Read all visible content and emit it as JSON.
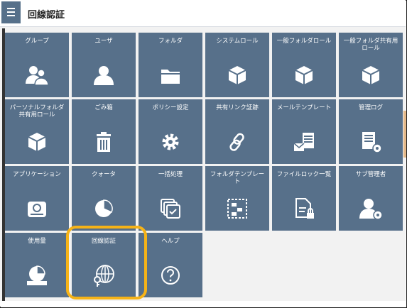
{
  "header": {
    "title": "回線認証"
  },
  "tiles": [
    {
      "label": "グループ",
      "icon": "group-icon"
    },
    {
      "label": "ユーザ",
      "icon": "user-icon"
    },
    {
      "label": "フォルダ",
      "icon": "folder-icon"
    },
    {
      "label": "システムロール",
      "icon": "cube-icon"
    },
    {
      "label": "一般フォルダロール",
      "icon": "cube-icon"
    },
    {
      "label": "一般フォルダ共有用ロール",
      "icon": "cube-icon"
    },
    {
      "label": "パーソナルフォルダ共有用ロール",
      "icon": "cube-icon"
    },
    {
      "label": "ごみ箱",
      "icon": "trash-icon"
    },
    {
      "label": "ポリシー設定",
      "icon": "gear-icon"
    },
    {
      "label": "共有リンク証跡",
      "icon": "link-icon"
    },
    {
      "label": "メールテンプレート",
      "icon": "mail-template-icon"
    },
    {
      "label": "管理ログ",
      "icon": "log-settings-icon"
    },
    {
      "label": "アプリケーション",
      "icon": "drive-icon"
    },
    {
      "label": "クォータ",
      "icon": "pie-chart-icon"
    },
    {
      "label": "一括処理",
      "icon": "batch-icon"
    },
    {
      "label": "フォルダテンプレート",
      "icon": "folder-template-icon"
    },
    {
      "label": "ファイルロック一覧",
      "icon": "file-lock-icon"
    },
    {
      "label": "サブ管理者",
      "icon": "sub-admin-icon"
    },
    {
      "label": "使用量",
      "icon": "usage-icon"
    },
    {
      "label": "回線認証",
      "icon": "globe-key-icon"
    },
    {
      "label": "ヘルプ",
      "icon": "help-icon"
    }
  ],
  "colors": {
    "tile": "#57708a",
    "highlight": "#f6b317",
    "header_button": "#56708a"
  }
}
